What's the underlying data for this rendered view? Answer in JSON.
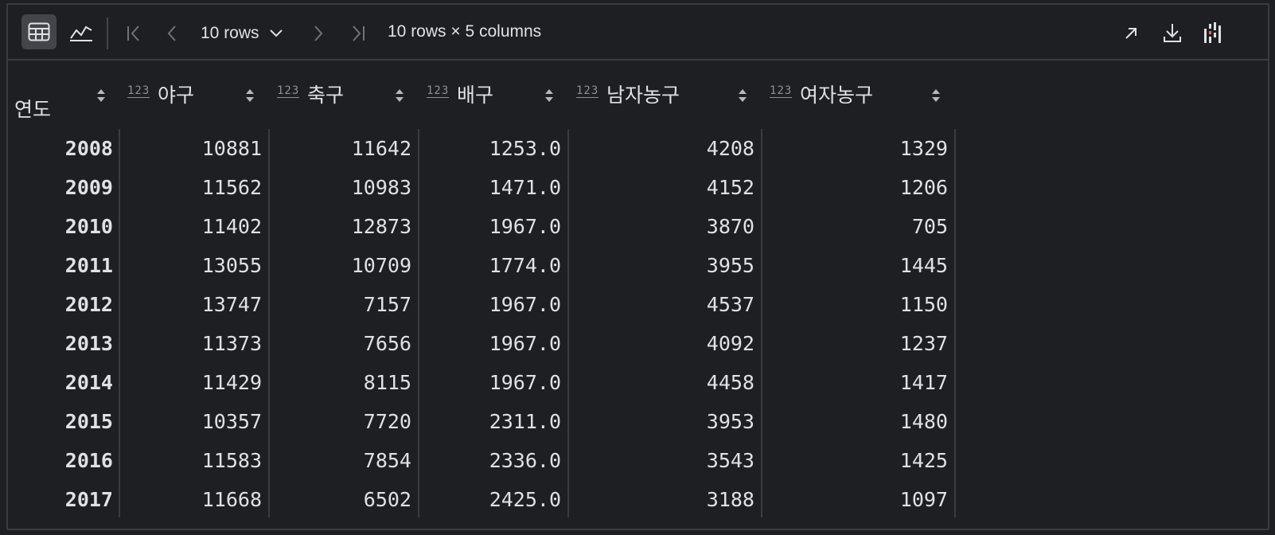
{
  "toolbar": {
    "rows_label": "10 rows",
    "summary": "10 rows × 5 columns"
  },
  "table": {
    "index_header": "연도",
    "type_label": "123",
    "columns": [
      "야구",
      "축구",
      "배구",
      "남자농구",
      "여자농구"
    ],
    "rows": [
      [
        "2008",
        "10881",
        "11642",
        "1253.0",
        "4208",
        "1329"
      ],
      [
        "2009",
        "11562",
        "10983",
        "1471.0",
        "4152",
        "1206"
      ],
      [
        "2010",
        "11402",
        "12873",
        "1967.0",
        "3870",
        "705"
      ],
      [
        "2011",
        "13055",
        "10709",
        "1774.0",
        "3955",
        "1445"
      ],
      [
        "2012",
        "13747",
        "7157",
        "1967.0",
        "4537",
        "1150"
      ],
      [
        "2013",
        "11373",
        "7656",
        "1967.0",
        "4092",
        "1237"
      ],
      [
        "2014",
        "11429",
        "8115",
        "1967.0",
        "4458",
        "1417"
      ],
      [
        "2015",
        "10357",
        "7720",
        "2311.0",
        "3953",
        "1480"
      ],
      [
        "2016",
        "11583",
        "7854",
        "2336.0",
        "3543",
        "1425"
      ],
      [
        "2017",
        "11668",
        "6502",
        "2425.0",
        "3188",
        "1097"
      ]
    ]
  },
  "icons": {
    "table_view": "table-view-icon",
    "chart_view": "chart-view-icon",
    "first_page": "first-page-icon",
    "prev_page": "prev-page-icon",
    "next_page": "next-page-icon",
    "last_page": "last-page-icon",
    "dropdown": "chevron-down-icon",
    "open_in_editor": "arrow-up-right-icon",
    "download": "download-icon",
    "column_settings": "columns-settings-icon",
    "sort": "sort-icon"
  },
  "colors": {
    "background": "#1e1f22",
    "border": "#393b40",
    "text": "#dfe1e5",
    "muted": "#8c8f94",
    "active_button": "#43454a"
  }
}
